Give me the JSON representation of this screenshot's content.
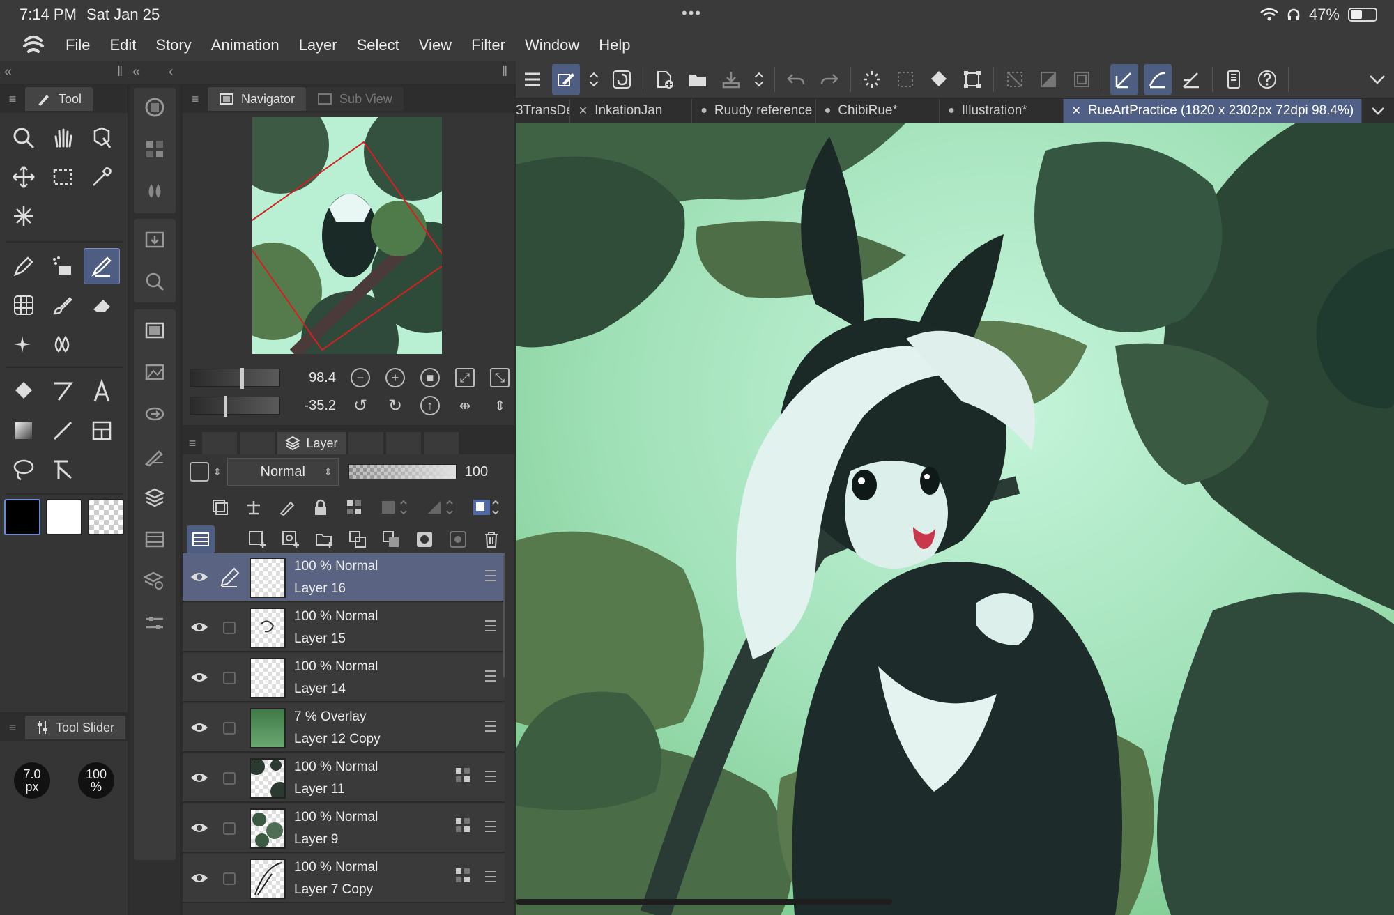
{
  "status": {
    "time": "7:14 PM",
    "date": "Sat Jan 25",
    "battery": "47%",
    "battery_level": 0.47
  },
  "menu": [
    "File",
    "Edit",
    "Story",
    "Animation",
    "Layer",
    "Select",
    "View",
    "Filter",
    "Window",
    "Help"
  ],
  "tool_panel": {
    "tab_label": "Tool",
    "slider_tab_label": "Tool Slider",
    "brush_size_value": "7.0",
    "brush_size_unit": "px",
    "opacity_value": "100",
    "opacity_unit": "%"
  },
  "navigator": {
    "tab_label": "Navigator",
    "subview_label": "Sub View",
    "zoom_value": "98.4",
    "rotation_value": "-35.2"
  },
  "layer_panel": {
    "tab_label": "Layer",
    "blend_mode": "Normal",
    "opacity": "100",
    "layers": [
      {
        "mode": "100 % Normal",
        "name": "Layer 16",
        "selected": true
      },
      {
        "mode": "100 % Normal",
        "name": "Layer 15",
        "selected": false
      },
      {
        "mode": "100 % Normal",
        "name": "Layer 14",
        "selected": false
      },
      {
        "mode": "7 % Overlay",
        "name": "Layer 12 Copy",
        "selected": false
      },
      {
        "mode": "100 % Normal",
        "name": "Layer 11",
        "selected": false
      },
      {
        "mode": "100 % Normal",
        "name": "Layer 9",
        "selected": false
      },
      {
        "mode": "100 % Normal",
        "name": "Layer 7 Copy",
        "selected": false
      }
    ]
  },
  "documents": [
    {
      "label": "3TransDe",
      "marker": "",
      "active": false
    },
    {
      "label": "InkationJan",
      "marker": "close",
      "active": false
    },
    {
      "label": "Ruudy reference",
      "marker": "dot",
      "active": false
    },
    {
      "label": "ChibiRue*",
      "marker": "dot",
      "active": false
    },
    {
      "label": "Illustration*",
      "marker": "dot",
      "active": false
    },
    {
      "label": "RueArtPractice (1820 x 2302px 72dpi 98.4%)",
      "marker": "close",
      "active": true
    }
  ],
  "colors": {
    "accent": "#4e5d82",
    "panel": "#353535",
    "canvas_sky": "#9be8c8",
    "leaf_dark": "#2f4a3a",
    "leaf_mid": "#5a7a4e"
  }
}
